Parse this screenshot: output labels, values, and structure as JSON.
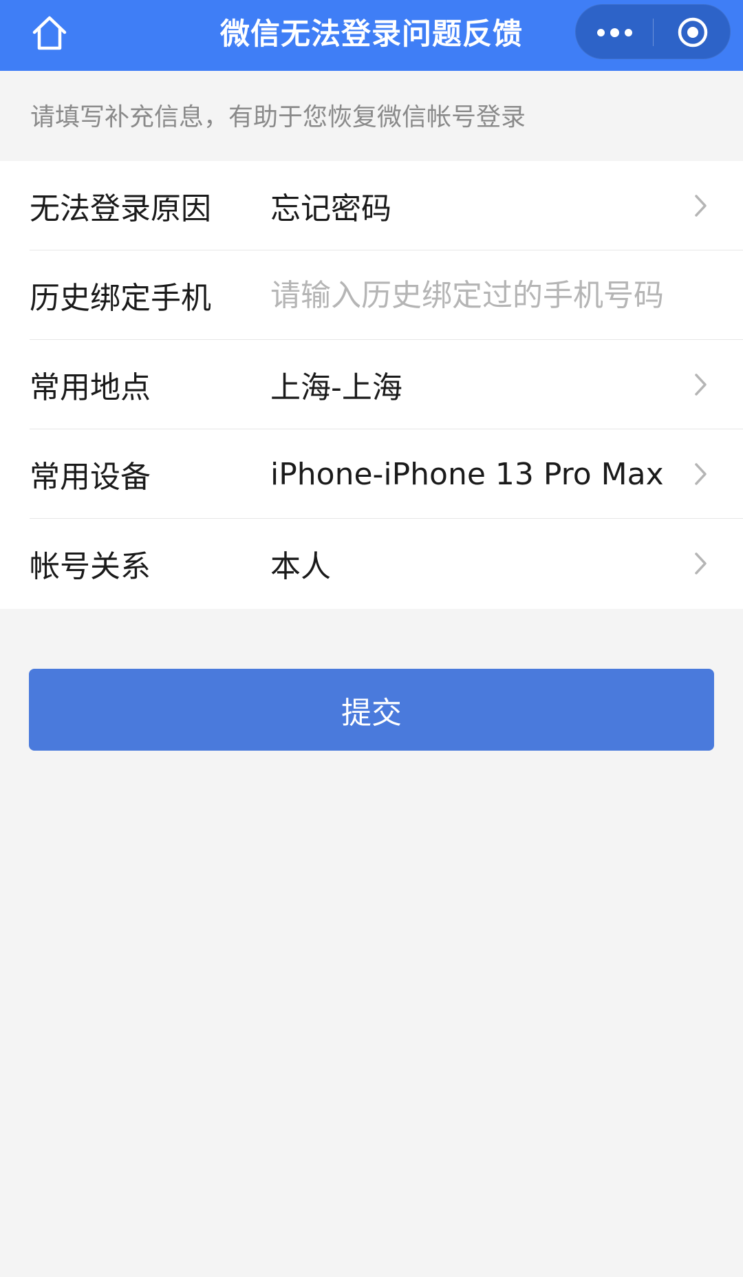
{
  "navbar": {
    "title": "微信无法登录问题反馈",
    "home_icon": "home-icon",
    "more_icon": "more-dots-icon",
    "close_icon": "target-circle-icon",
    "bg_color": "#3f7ef6"
  },
  "hint": "请填写补充信息，有助于您恢复微信帐号登录",
  "form": {
    "rows": [
      {
        "label": "无法登录原因",
        "value": "忘记密码",
        "has_arrow": true
      },
      {
        "label": "历史绑定手机",
        "value": "",
        "placeholder": "请输入历史绑定过的手机号码",
        "has_arrow": false
      },
      {
        "label": "常用地点",
        "value": "上海-上海",
        "has_arrow": true
      },
      {
        "label": "常用设备",
        "value": "iPhone-iPhone 13 Pro Max",
        "has_arrow": true
      },
      {
        "label": "帐号关系",
        "value": "本人",
        "has_arrow": true
      }
    ]
  },
  "submit_label": "提交",
  "colors": {
    "accent": "#3f7ef6",
    "button": "#4a7adc",
    "background": "#f4f4f4"
  }
}
